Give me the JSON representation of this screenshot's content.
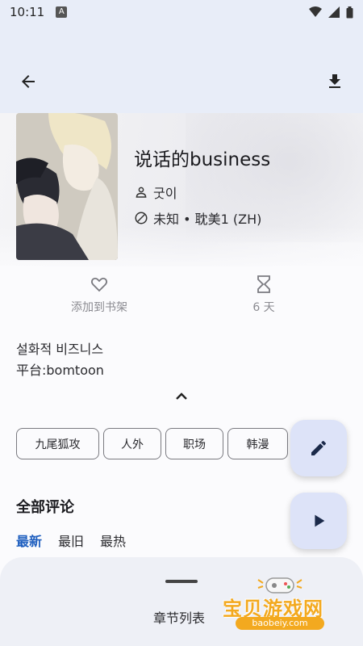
{
  "status_bar": {
    "time": "10:11",
    "notif_glyph": "A"
  },
  "book": {
    "title": "说话的business",
    "author": "굿이",
    "status_line": "未知 • 耽美1 (ZH)"
  },
  "actions": {
    "favorite_label": "添加到书架",
    "interval_label": "6 天"
  },
  "description": {
    "line1": "설화적 비즈니스",
    "line2": "平台:bomtoon"
  },
  "tags": [
    "九尾狐攻",
    "人外",
    "职场",
    "韩漫"
  ],
  "comments": {
    "title": "全部评论",
    "sort_tabs": [
      "最新",
      "最旧",
      "最热"
    ],
    "active_tab": "最新"
  },
  "bottom_sheet": {
    "label": "章节列表"
  },
  "watermark": {
    "text": "宝贝游戏网",
    "url": "baobeiy.com"
  },
  "colors": {
    "accent": "#1f5fbf",
    "fab_bg": "#dde3f8",
    "app_bar_bg": "#e8edf8"
  }
}
